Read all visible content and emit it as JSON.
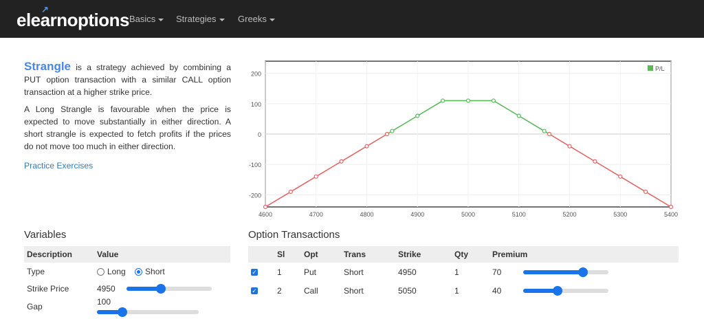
{
  "nav": {
    "brand": "elearnoptions",
    "items": [
      "Basics",
      "Strategies",
      "Greeks"
    ]
  },
  "intro": {
    "term": "Strangle",
    "sentence1": "is a strategy achieved by combining a PUT option transaction with a similar CALL option transaction at a higher strike price.",
    "paragraph2": "A Long Strangle is favourable when the price is expected to move substantially in either direction. A short strangle is expected to fetch profits if the prices do not move too much in either direction.",
    "practice_link": "Practice Exercises"
  },
  "chart_data": {
    "type": "line",
    "legend": "P/L",
    "legend_position": "top-right",
    "positive_color": "#5cb85c",
    "negative_color": "#e06666",
    "xlim": [
      4600,
      5400
    ],
    "ylim": [
      -240,
      240
    ],
    "x_ticks": [
      4600,
      4700,
      4800,
      4900,
      5000,
      5100,
      5200,
      5300,
      5400
    ],
    "y_ticks": [
      200,
      100,
      0,
      -100,
      -200
    ],
    "grid": true,
    "x": [
      4600,
      4650,
      4700,
      4750,
      4800,
      4840,
      4850,
      4900,
      4950,
      5000,
      5050,
      5100,
      5150,
      5160,
      5200,
      5250,
      5300,
      5350,
      5400
    ],
    "y": [
      -240,
      -190,
      -140,
      -90,
      -40,
      0,
      10,
      60,
      110,
      110,
      110,
      60,
      10,
      0,
      -40,
      -90,
      -140,
      -190,
      -240
    ]
  },
  "variables": {
    "title": "Variables",
    "headers": [
      "Description",
      "Value"
    ],
    "type_label": "Type",
    "long_label": "Long",
    "short_label": "Short",
    "selected_type": "Short",
    "strike_label": "Strike Price",
    "strike_value": "4950",
    "strike_slider": 0.4,
    "gap_label": "Gap",
    "gap_value": "100",
    "gap_slider": 0.25
  },
  "transactions": {
    "title": "Option Transactions",
    "headers": [
      "Sl",
      "Opt",
      "Trans",
      "Strike",
      "Qty",
      "Premium"
    ],
    "rows": [
      {
        "sl": "1",
        "opt": "Put",
        "trans": "Short",
        "strike": "4950",
        "qty": "1",
        "premium": "70",
        "slider": 0.7
      },
      {
        "sl": "2",
        "opt": "Call",
        "trans": "Short",
        "strike": "5050",
        "qty": "1",
        "premium": "40",
        "slider": 0.4
      }
    ]
  }
}
